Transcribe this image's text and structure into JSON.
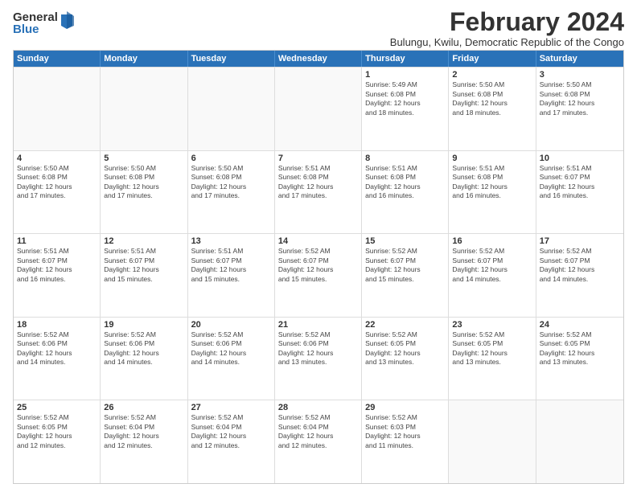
{
  "logo": {
    "general": "General",
    "blue": "Blue"
  },
  "title": "February 2024",
  "subtitle": "Bulungu, Kwilu, Democratic Republic of the Congo",
  "days_of_week": [
    "Sunday",
    "Monday",
    "Tuesday",
    "Wednesday",
    "Thursday",
    "Friday",
    "Saturday"
  ],
  "weeks": [
    [
      {
        "day": "",
        "info": ""
      },
      {
        "day": "",
        "info": ""
      },
      {
        "day": "",
        "info": ""
      },
      {
        "day": "",
        "info": ""
      },
      {
        "day": "1",
        "info": "Sunrise: 5:49 AM\nSunset: 6:08 PM\nDaylight: 12 hours\nand 18 minutes."
      },
      {
        "day": "2",
        "info": "Sunrise: 5:50 AM\nSunset: 6:08 PM\nDaylight: 12 hours\nand 18 minutes."
      },
      {
        "day": "3",
        "info": "Sunrise: 5:50 AM\nSunset: 6:08 PM\nDaylight: 12 hours\nand 17 minutes."
      }
    ],
    [
      {
        "day": "4",
        "info": "Sunrise: 5:50 AM\nSunset: 6:08 PM\nDaylight: 12 hours\nand 17 minutes."
      },
      {
        "day": "5",
        "info": "Sunrise: 5:50 AM\nSunset: 6:08 PM\nDaylight: 12 hours\nand 17 minutes."
      },
      {
        "day": "6",
        "info": "Sunrise: 5:50 AM\nSunset: 6:08 PM\nDaylight: 12 hours\nand 17 minutes."
      },
      {
        "day": "7",
        "info": "Sunrise: 5:51 AM\nSunset: 6:08 PM\nDaylight: 12 hours\nand 17 minutes."
      },
      {
        "day": "8",
        "info": "Sunrise: 5:51 AM\nSunset: 6:08 PM\nDaylight: 12 hours\nand 16 minutes."
      },
      {
        "day": "9",
        "info": "Sunrise: 5:51 AM\nSunset: 6:08 PM\nDaylight: 12 hours\nand 16 minutes."
      },
      {
        "day": "10",
        "info": "Sunrise: 5:51 AM\nSunset: 6:07 PM\nDaylight: 12 hours\nand 16 minutes."
      }
    ],
    [
      {
        "day": "11",
        "info": "Sunrise: 5:51 AM\nSunset: 6:07 PM\nDaylight: 12 hours\nand 16 minutes."
      },
      {
        "day": "12",
        "info": "Sunrise: 5:51 AM\nSunset: 6:07 PM\nDaylight: 12 hours\nand 15 minutes."
      },
      {
        "day": "13",
        "info": "Sunrise: 5:51 AM\nSunset: 6:07 PM\nDaylight: 12 hours\nand 15 minutes."
      },
      {
        "day": "14",
        "info": "Sunrise: 5:52 AM\nSunset: 6:07 PM\nDaylight: 12 hours\nand 15 minutes."
      },
      {
        "day": "15",
        "info": "Sunrise: 5:52 AM\nSunset: 6:07 PM\nDaylight: 12 hours\nand 15 minutes."
      },
      {
        "day": "16",
        "info": "Sunrise: 5:52 AM\nSunset: 6:07 PM\nDaylight: 12 hours\nand 14 minutes."
      },
      {
        "day": "17",
        "info": "Sunrise: 5:52 AM\nSunset: 6:07 PM\nDaylight: 12 hours\nand 14 minutes."
      }
    ],
    [
      {
        "day": "18",
        "info": "Sunrise: 5:52 AM\nSunset: 6:06 PM\nDaylight: 12 hours\nand 14 minutes."
      },
      {
        "day": "19",
        "info": "Sunrise: 5:52 AM\nSunset: 6:06 PM\nDaylight: 12 hours\nand 14 minutes."
      },
      {
        "day": "20",
        "info": "Sunrise: 5:52 AM\nSunset: 6:06 PM\nDaylight: 12 hours\nand 14 minutes."
      },
      {
        "day": "21",
        "info": "Sunrise: 5:52 AM\nSunset: 6:06 PM\nDaylight: 12 hours\nand 13 minutes."
      },
      {
        "day": "22",
        "info": "Sunrise: 5:52 AM\nSunset: 6:05 PM\nDaylight: 12 hours\nand 13 minutes."
      },
      {
        "day": "23",
        "info": "Sunrise: 5:52 AM\nSunset: 6:05 PM\nDaylight: 12 hours\nand 13 minutes."
      },
      {
        "day": "24",
        "info": "Sunrise: 5:52 AM\nSunset: 6:05 PM\nDaylight: 12 hours\nand 13 minutes."
      }
    ],
    [
      {
        "day": "25",
        "info": "Sunrise: 5:52 AM\nSunset: 6:05 PM\nDaylight: 12 hours\nand 12 minutes."
      },
      {
        "day": "26",
        "info": "Sunrise: 5:52 AM\nSunset: 6:04 PM\nDaylight: 12 hours\nand 12 minutes."
      },
      {
        "day": "27",
        "info": "Sunrise: 5:52 AM\nSunset: 6:04 PM\nDaylight: 12 hours\nand 12 minutes."
      },
      {
        "day": "28",
        "info": "Sunrise: 5:52 AM\nSunset: 6:04 PM\nDaylight: 12 hours\nand 12 minutes."
      },
      {
        "day": "29",
        "info": "Sunrise: 5:52 AM\nSunset: 6:03 PM\nDaylight: 12 hours\nand 11 minutes."
      },
      {
        "day": "",
        "info": ""
      },
      {
        "day": "",
        "info": ""
      }
    ]
  ]
}
